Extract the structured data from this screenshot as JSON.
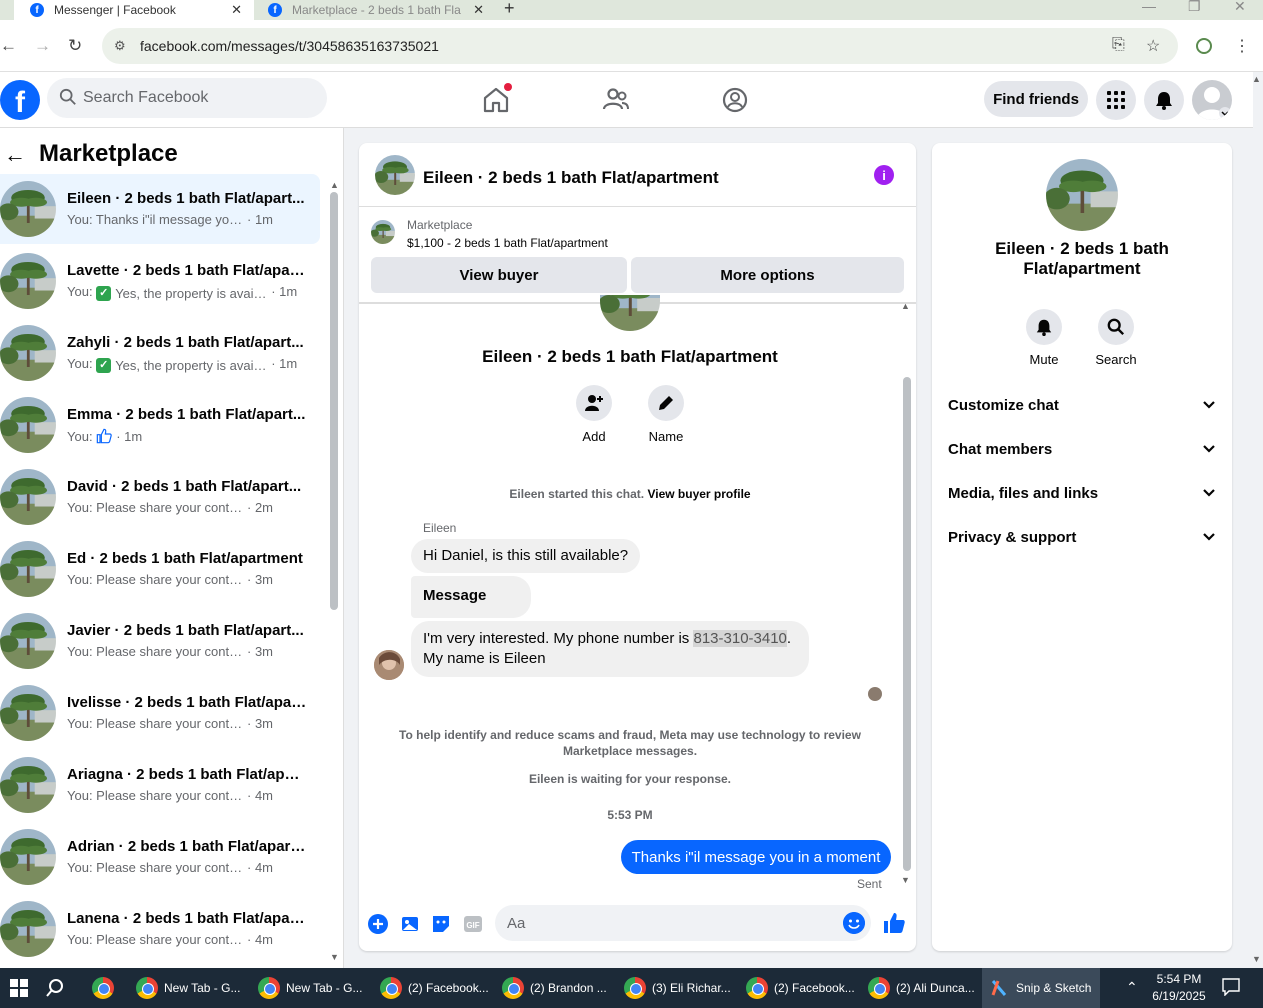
{
  "browser": {
    "tabs": [
      {
        "label": "Messenger | Facebook",
        "active": true
      },
      {
        "label": "Marketplace - 2 beds 1 bath Fla",
        "active": false
      }
    ],
    "url": "facebook.com/messages/t/30458635163735021"
  },
  "header": {
    "search_placeholder": "Search Facebook",
    "find_friends": "Find friends",
    "brand_color": "#0866ff"
  },
  "sidebar": {
    "title": "Marketplace",
    "conversations": [
      {
        "title": "Eileen · 2 beds 1 bath Flat/apart...",
        "preview": "You: Thanks i\"il message you in a ...",
        "ago": "· 1m",
        "check": false,
        "active": true
      },
      {
        "title": "Lavette · 2 beds 1 bath Flat/apar...",
        "preview": "Yes, the property is availa...",
        "prefix": "You:",
        "ago": "· 1m",
        "check": true
      },
      {
        "title": "Zahyli · 2 beds 1 bath Flat/apart...",
        "preview": "Yes, the property is availa...",
        "prefix": "You:",
        "ago": "· 1m",
        "check": true
      },
      {
        "title": "Emma · 2 beds 1 bath Flat/apart...",
        "preview": "You:",
        "ago": "· 1m",
        "check": false,
        "thumbs": true
      },
      {
        "title": "David · 2 beds 1 bath Flat/apart...",
        "preview": "You: Please share your contact nu...",
        "ago": "· 2m",
        "check": false
      },
      {
        "title": "Ed · 2 beds 1 bath Flat/apartment",
        "preview": "You: Please share your contact nu...",
        "ago": "· 3m",
        "check": false
      },
      {
        "title": "Javier · 2 beds 1 bath Flat/apart...",
        "preview": "You: Please share your contact nu...",
        "ago": "· 3m",
        "check": false
      },
      {
        "title": "Ivelisse · 2 beds 1 bath Flat/apar...",
        "preview": "You: Please share your contact nu...",
        "ago": "· 3m",
        "check": false
      },
      {
        "title": "Ariagna · 2 beds 1 bath Flat/apar...",
        "preview": "You: Please share your contact nu...",
        "ago": "· 4m",
        "check": false
      },
      {
        "title": "Adrian · 2 beds 1 bath Flat/apart...",
        "preview": "You: Please share your contact nu...",
        "ago": "· 4m",
        "check": false
      },
      {
        "title": "Lanena · 2 beds 1 bath Flat/apar...",
        "preview": "You: Please share your contact nu...",
        "ago": "· 4m",
        "check": false
      }
    ]
  },
  "chat": {
    "title": "Eileen · 2 beds 1 bath Flat/apartment",
    "marketplace_label": "Marketplace",
    "listing": "$1,100 - 2 beds 1 bath Flat/apartment",
    "view_buyer": "View buyer",
    "more_options": "More options",
    "add_label": "Add",
    "name_label": "Name",
    "started_text": "Eileen started this chat.",
    "view_profile": "View buyer profile",
    "sender": "Eileen",
    "msg1": "Hi Daniel, is this still available?",
    "msg2": "Message sent",
    "msg3_a": "I'm very interested.  My phone number is ",
    "msg3_phone": "813-310-3410",
    "msg3_b": ".",
    "msg3_c": "My name is Eileen",
    "scam_notice": "To help identify and reduce scams and fraud, Meta may use technology to review Marketplace messages.",
    "waiting": "Eileen is waiting for your response.",
    "time": "5:53 PM",
    "outgoing": "Thanks i\"il message you in a moment",
    "sent": "Sent",
    "composer_placeholder": "Aa"
  },
  "right": {
    "title": "Eileen · 2 beds 1 bath Flat/apartment",
    "mute": "Mute",
    "search": "Search",
    "rows": [
      "Customize chat",
      "Chat members",
      "Media, files and links",
      "Privacy & support"
    ]
  },
  "taskbar": {
    "items": [
      {
        "label": "New Tab - G..."
      },
      {
        "label": "New Tab - G..."
      },
      {
        "label": "(2) Facebook..."
      },
      {
        "label": "(2) Brandon ..."
      },
      {
        "label": "(3) Eli Richar..."
      },
      {
        "label": "(2) Facebook..."
      },
      {
        "label": "(2) Ali Dunca..."
      },
      {
        "label": "Snip & Sketch"
      }
    ],
    "time": "5:54 PM",
    "date": "6/19/2025"
  }
}
